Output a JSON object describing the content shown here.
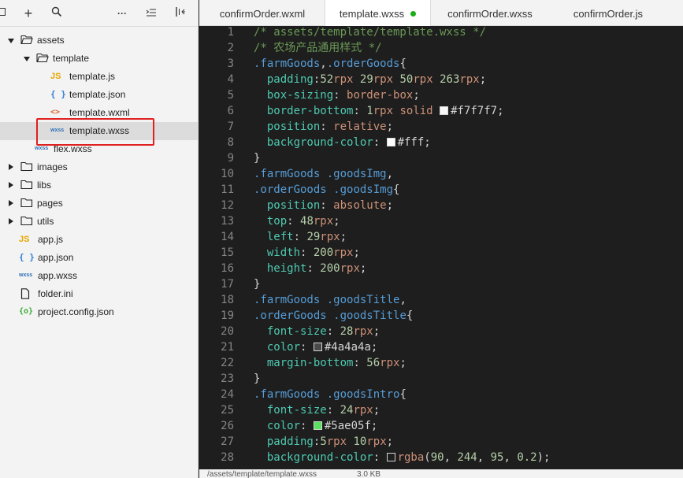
{
  "toolbar": {
    "icons": [
      "collapse-icon",
      "add-icon",
      "search-icon",
      "more-icon",
      "outline-icon",
      "split-icon"
    ],
    "add_label": "+",
    "more_label": "···"
  },
  "tree": [
    {
      "label": "assets",
      "type": "folder",
      "open": true,
      "depth": 0
    },
    {
      "label": "template",
      "type": "folder",
      "open": true,
      "depth": 1
    },
    {
      "label": "template.js",
      "type": "js",
      "depth": 2
    },
    {
      "label": "template.json",
      "type": "json",
      "depth": 2
    },
    {
      "label": "template.wxml",
      "type": "wxml",
      "depth": 2
    },
    {
      "label": "template.wxss",
      "type": "wxss",
      "depth": 2,
      "selected": true
    },
    {
      "label": "flex.wxss",
      "type": "wxss",
      "depth": 1
    },
    {
      "label": "images",
      "type": "folder",
      "open": false,
      "depth": 0
    },
    {
      "label": "libs",
      "type": "folder",
      "open": false,
      "depth": 0
    },
    {
      "label": "pages",
      "type": "folder",
      "open": false,
      "depth": 0
    },
    {
      "label": "utils",
      "type": "folder",
      "open": false,
      "depth": 0
    },
    {
      "label": "app.js",
      "type": "js",
      "depth": 0
    },
    {
      "label": "app.json",
      "type": "json",
      "depth": 0
    },
    {
      "label": "app.wxss",
      "type": "wxss",
      "depth": 0
    },
    {
      "label": "folder.ini",
      "type": "file",
      "depth": 0
    },
    {
      "label": "project.config.json",
      "type": "config",
      "depth": 0
    }
  ],
  "icon_text": {
    "js": "JS",
    "json": "{ }",
    "wxml": "<>",
    "wxss": "wxss",
    "config": "{o}"
  },
  "tabs": [
    {
      "label": "confirmOrder.wxml",
      "active": false
    },
    {
      "label": "template.wxss",
      "active": true,
      "modified": true
    },
    {
      "label": "confirmOrder.wxss",
      "active": false
    },
    {
      "label": "confirmOrder.js",
      "active": false
    }
  ],
  "code_lines": [
    [
      [
        "c-comment",
        "/* assets/template/template.wxss */"
      ]
    ],
    [
      [
        "c-comment",
        "/* 农场产品通用样式 */"
      ]
    ],
    [
      [
        "c-sel",
        ".farmGoods"
      ],
      [
        "c-pun",
        ","
      ],
      [
        "c-sel",
        ".orderGoods"
      ],
      [
        "c-pun",
        "{"
      ]
    ],
    [
      [
        "c-pun",
        "  "
      ],
      [
        "c-prop",
        "padding"
      ],
      [
        "c-pun",
        ":"
      ],
      [
        "c-num",
        "52"
      ],
      [
        "c-unit",
        "rpx"
      ],
      [
        "c-pun",
        " "
      ],
      [
        "c-num",
        "29"
      ],
      [
        "c-unit",
        "rpx"
      ],
      [
        "c-pun",
        " "
      ],
      [
        "c-num",
        "50"
      ],
      [
        "c-unit",
        "rpx"
      ],
      [
        "c-pun",
        " "
      ],
      [
        "c-num",
        "263"
      ],
      [
        "c-unit",
        "rpx"
      ],
      [
        "c-pun",
        ";"
      ]
    ],
    [
      [
        "c-pun",
        "  "
      ],
      [
        "c-prop",
        "box-sizing"
      ],
      [
        "c-pun",
        ": "
      ],
      [
        "c-kw",
        "border-box"
      ],
      [
        "c-pun",
        ";"
      ]
    ],
    [
      [
        "c-pun",
        "  "
      ],
      [
        "c-prop",
        "border-bottom"
      ],
      [
        "c-pun",
        ": "
      ],
      [
        "c-num",
        "1"
      ],
      [
        "c-unit",
        "rpx"
      ],
      [
        "c-pun",
        " "
      ],
      [
        "c-kw",
        "solid"
      ],
      [
        "c-pun",
        " "
      ],
      [
        "swatch",
        "#f7f7f7"
      ],
      [
        "c-val",
        "#f7f7f7"
      ],
      [
        "c-pun",
        ";"
      ]
    ],
    [
      [
        "c-pun",
        "  "
      ],
      [
        "c-prop",
        "position"
      ],
      [
        "c-pun",
        ": "
      ],
      [
        "c-kw",
        "relative"
      ],
      [
        "c-pun",
        ";"
      ]
    ],
    [
      [
        "c-pun",
        "  "
      ],
      [
        "c-prop",
        "background-color"
      ],
      [
        "c-pun",
        ": "
      ],
      [
        "swatch",
        "#fff"
      ],
      [
        "c-val",
        "#fff"
      ],
      [
        "c-pun",
        ";"
      ]
    ],
    [
      [
        "c-pun",
        "}"
      ]
    ],
    [
      [
        "c-sel",
        ".farmGoods"
      ],
      [
        "c-pun",
        " "
      ],
      [
        "c-sel",
        ".goodsImg"
      ],
      [
        "c-pun",
        ","
      ]
    ],
    [
      [
        "c-sel",
        ".orderGoods"
      ],
      [
        "c-pun",
        " "
      ],
      [
        "c-sel",
        ".goodsImg"
      ],
      [
        "c-pun",
        "{"
      ]
    ],
    [
      [
        "c-pun",
        "  "
      ],
      [
        "c-prop",
        "position"
      ],
      [
        "c-pun",
        ": "
      ],
      [
        "c-kw",
        "absolute"
      ],
      [
        "c-pun",
        ";"
      ]
    ],
    [
      [
        "c-pun",
        "  "
      ],
      [
        "c-prop",
        "top"
      ],
      [
        "c-pun",
        ": "
      ],
      [
        "c-num",
        "48"
      ],
      [
        "c-unit",
        "rpx"
      ],
      [
        "c-pun",
        ";"
      ]
    ],
    [
      [
        "c-pun",
        "  "
      ],
      [
        "c-prop",
        "left"
      ],
      [
        "c-pun",
        ": "
      ],
      [
        "c-num",
        "29"
      ],
      [
        "c-unit",
        "rpx"
      ],
      [
        "c-pun",
        ";"
      ]
    ],
    [
      [
        "c-pun",
        "  "
      ],
      [
        "c-prop",
        "width"
      ],
      [
        "c-pun",
        ": "
      ],
      [
        "c-num",
        "200"
      ],
      [
        "c-unit",
        "rpx"
      ],
      [
        "c-pun",
        ";"
      ]
    ],
    [
      [
        "c-pun",
        "  "
      ],
      [
        "c-prop",
        "height"
      ],
      [
        "c-pun",
        ": "
      ],
      [
        "c-num",
        "200"
      ],
      [
        "c-unit",
        "rpx"
      ],
      [
        "c-pun",
        ";"
      ]
    ],
    [
      [
        "c-pun",
        "}"
      ]
    ],
    [
      [
        "c-sel",
        ".farmGoods"
      ],
      [
        "c-pun",
        " "
      ],
      [
        "c-sel",
        ".goodsTitle"
      ],
      [
        "c-pun",
        ","
      ]
    ],
    [
      [
        "c-sel",
        ".orderGoods"
      ],
      [
        "c-pun",
        " "
      ],
      [
        "c-sel",
        ".goodsTitle"
      ],
      [
        "c-pun",
        "{"
      ]
    ],
    [
      [
        "c-pun",
        "  "
      ],
      [
        "c-prop",
        "font-size"
      ],
      [
        "c-pun",
        ": "
      ],
      [
        "c-num",
        "28"
      ],
      [
        "c-unit",
        "rpx"
      ],
      [
        "c-pun",
        ";"
      ]
    ],
    [
      [
        "c-pun",
        "  "
      ],
      [
        "c-prop",
        "color"
      ],
      [
        "c-pun",
        ": "
      ],
      [
        "swatch",
        "#4a4a4a"
      ],
      [
        "c-val",
        "#4a4a4a"
      ],
      [
        "c-pun",
        ";"
      ]
    ],
    [
      [
        "c-pun",
        "  "
      ],
      [
        "c-prop",
        "margin-bottom"
      ],
      [
        "c-pun",
        ": "
      ],
      [
        "c-num",
        "56"
      ],
      [
        "c-unit",
        "rpx"
      ],
      [
        "c-pun",
        ";"
      ]
    ],
    [
      [
        "c-pun",
        "}"
      ]
    ],
    [
      [
        "c-sel",
        ".farmGoods"
      ],
      [
        "c-pun",
        " "
      ],
      [
        "c-sel",
        ".goodsIntro"
      ],
      [
        "c-pun",
        "{"
      ]
    ],
    [
      [
        "c-pun",
        "  "
      ],
      [
        "c-prop",
        "font-size"
      ],
      [
        "c-pun",
        ": "
      ],
      [
        "c-num",
        "24"
      ],
      [
        "c-unit",
        "rpx"
      ],
      [
        "c-pun",
        ";"
      ]
    ],
    [
      [
        "c-pun",
        "  "
      ],
      [
        "c-prop",
        "color"
      ],
      [
        "c-pun",
        ": "
      ],
      [
        "swatch",
        "#5ae05f"
      ],
      [
        "c-val",
        "#5ae05f"
      ],
      [
        "c-pun",
        ";"
      ]
    ],
    [
      [
        "c-pun",
        "  "
      ],
      [
        "c-prop",
        "padding"
      ],
      [
        "c-pun",
        ":"
      ],
      [
        "c-num",
        "5"
      ],
      [
        "c-unit",
        "rpx"
      ],
      [
        "c-pun",
        " "
      ],
      [
        "c-num",
        "10"
      ],
      [
        "c-unit",
        "rpx"
      ],
      [
        "c-pun",
        ";"
      ]
    ],
    [
      [
        "c-pun",
        "  "
      ],
      [
        "c-prop",
        "background-color"
      ],
      [
        "c-pun",
        ": "
      ],
      [
        "swatch",
        "#1e1e1e"
      ],
      [
        "c-unit",
        "rgba"
      ],
      [
        "c-pun",
        "("
      ],
      [
        "c-num",
        "90"
      ],
      [
        "c-pun",
        ", "
      ],
      [
        "c-num",
        "244"
      ],
      [
        "c-pun",
        ", "
      ],
      [
        "c-num",
        "95"
      ],
      [
        "c-pun",
        ", "
      ],
      [
        "c-num",
        "0.2"
      ],
      [
        "c-pun",
        ");"
      ]
    ]
  ],
  "status": {
    "path": "/assets/template/template.wxss",
    "size": "3.0 KB"
  },
  "colors": {
    "highlight": "#e02020",
    "modified_dot": "#1aad19",
    "editor_bg": "#1e1e1e"
  }
}
